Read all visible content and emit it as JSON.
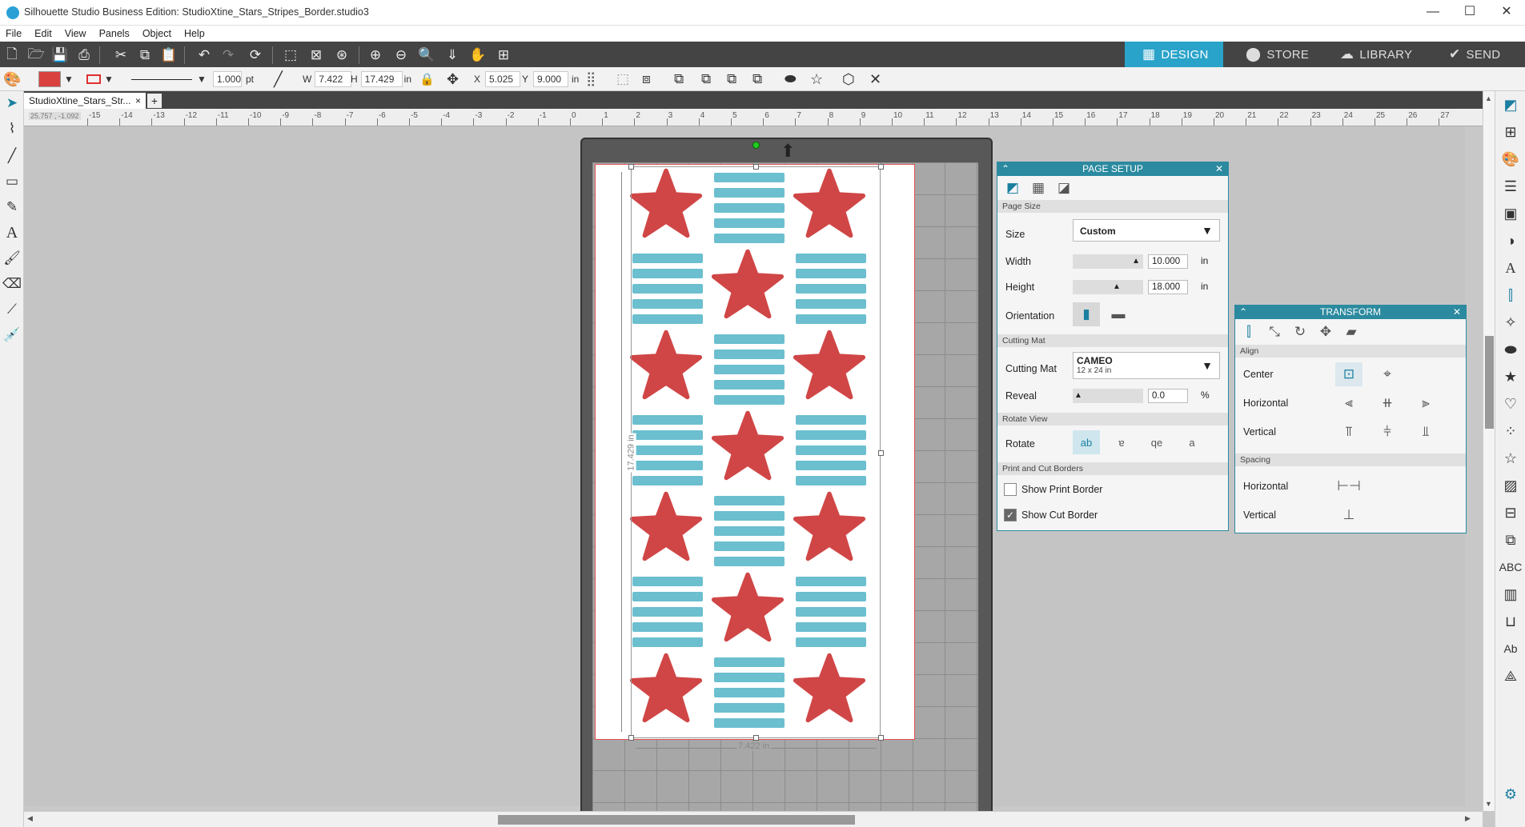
{
  "window": {
    "title": "Silhouette Studio Business Edition: StudioXtine_Stars_Stripes_Border.studio3"
  },
  "menu": [
    "File",
    "Edit",
    "View",
    "Panels",
    "Object",
    "Help"
  ],
  "nav_tabs": [
    {
      "label": "DESIGN",
      "icon": "design-grid-icon",
      "active": true
    },
    {
      "label": "STORE",
      "icon": "store-icon",
      "active": false
    },
    {
      "label": "LIBRARY",
      "icon": "cloud-library-icon",
      "active": false
    },
    {
      "label": "SEND",
      "icon": "send-check-icon",
      "active": false
    }
  ],
  "toolbar2": {
    "line_weight": "1.000",
    "line_unit": "pt",
    "w_label": "W",
    "w_value": "7.422",
    "h_label": "H",
    "h_value": "17.429",
    "size_unit": "in",
    "x_label": "X",
    "x_value": "5.025",
    "y_label": "Y",
    "y_value": "9.000",
    "pos_unit": "in",
    "fill_color": "#d9413f",
    "line_color": "#e03030"
  },
  "document_tab": {
    "name": "StudioXtine_Stars_Str...",
    "close": "×",
    "add": "+"
  },
  "ruler": {
    "corner_readout": "25.757 , -1.092",
    "h_ticks": [
      "-15",
      "-14",
      "-13",
      "-12",
      "-11",
      "-10",
      "-9",
      "-8",
      "-7",
      "-6",
      "-5",
      "-4",
      "-3",
      "-2",
      "-1",
      "0",
      "1",
      "2",
      "3",
      "4",
      "5",
      "6",
      "7",
      "8",
      "9",
      "10",
      "11",
      "12",
      "13",
      "14",
      "15",
      "16",
      "17",
      "18",
      "19",
      "20",
      "21",
      "22",
      "23",
      "24",
      "25",
      "26",
      "27"
    ]
  },
  "canvas": {
    "dim_height": "17.429 in",
    "dim_width": "7.422 in",
    "star_color": "#d04646",
    "stripe_color": "#6bbfcf"
  },
  "page_setup": {
    "title": "PAGE SETUP",
    "section_page_size": "Page Size",
    "size_label": "Size",
    "size_value": "Custom",
    "width_label": "Width",
    "width_value": "10.000",
    "width_unit": "in",
    "height_label": "Height",
    "height_value": "18.000",
    "height_unit": "in",
    "orientation_label": "Orientation",
    "section_cutting_mat": "Cutting Mat",
    "cutting_mat_label": "Cutting Mat",
    "cutting_mat_value": "CAMEO",
    "cutting_mat_sub": "12 x 24 in",
    "reveal_label": "Reveal",
    "reveal_value": "0.0",
    "reveal_unit": "%",
    "section_rotate": "Rotate View",
    "rotate_label": "Rotate",
    "section_borders": "Print and Cut Borders",
    "show_print_border": "Show Print Border",
    "show_print_border_checked": false,
    "show_cut_border": "Show Cut Border",
    "show_cut_border_checked": true
  },
  "transform": {
    "title": "TRANSFORM",
    "section_align": "Align",
    "center_label": "Center",
    "horizontal_label": "Horizontal",
    "vertical_label": "Vertical",
    "section_spacing": "Spacing",
    "spacing_horizontal_label": "Horizontal",
    "spacing_vertical_label": "Vertical"
  },
  "accent_color": "#2b8a9f"
}
